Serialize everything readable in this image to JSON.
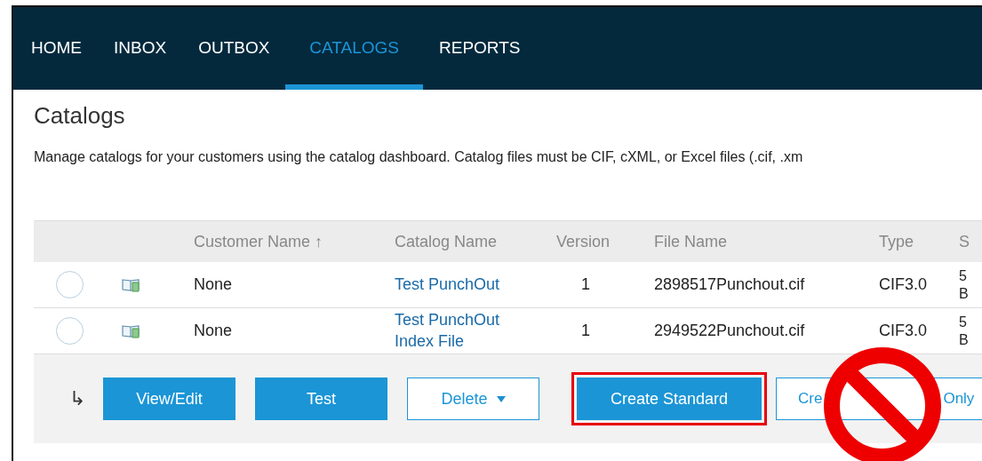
{
  "nav": {
    "tabs": [
      {
        "label": "HOME",
        "selected": false
      },
      {
        "label": "INBOX",
        "selected": false
      },
      {
        "label": "OUTBOX",
        "selected": false
      },
      {
        "label": "CATALOGS",
        "selected": true
      },
      {
        "label": "REPORTS",
        "selected": false
      }
    ]
  },
  "page": {
    "title": "Catalogs",
    "description": "Manage catalogs for your customers using the catalog dashboard. Catalog files must be CIF, cXML, or Excel files (.cif, .xm"
  },
  "table": {
    "columns": [
      "",
      "",
      "Customer Name ↑",
      "Catalog Name",
      "Version",
      "File Name",
      "Type",
      "S"
    ],
    "rows": [
      {
        "selected": false,
        "customer": "None",
        "catalog": "Test PunchOut",
        "version": "1",
        "file": "2898517Punchout.cif",
        "type": "CIF3.0",
        "column_8": "5 B"
      },
      {
        "selected": false,
        "customer": "None",
        "catalog": "Test PunchOut Index File",
        "version": "1",
        "file": "2949522Punchout.cif",
        "type": "CIF3.0",
        "column_8": "5 B"
      }
    ]
  },
  "actions": {
    "arrow": "↳",
    "buttons": [
      {
        "kind": "primary",
        "label": "View/Edit",
        "highlighted": false,
        "prohibited": false
      },
      {
        "kind": "primary",
        "label": "Test",
        "highlighted": false,
        "prohibited": false
      },
      {
        "kind": "dropdown",
        "label": "Delete",
        "highlighted": false,
        "prohibited": false
      },
      {
        "kind": "separator"
      },
      {
        "kind": "primary",
        "label": "Create Standard",
        "highlighted": true,
        "prohibited": false
      },
      {
        "kind": "outline",
        "label": "Cre",
        "label_end": "Only",
        "highlighted": false,
        "prohibited": true
      }
    ]
  }
}
